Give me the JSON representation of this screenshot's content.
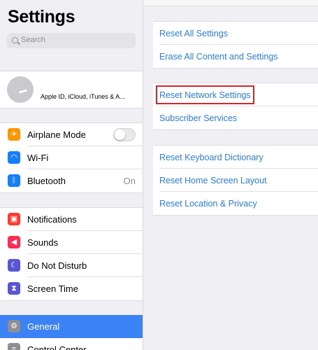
{
  "sidebar": {
    "title": "Settings",
    "search_placeholder": "Search",
    "profile_subtitle": "Apple ID, iCloud, iTunes & A...",
    "group1": [
      {
        "label": "Airplane Mode",
        "icon": "airplane-icon",
        "color": "#ff9500",
        "toggle": false
      },
      {
        "label": "Wi-Fi",
        "icon": "wifi-icon",
        "color": "#147efb"
      },
      {
        "label": "Bluetooth",
        "icon": "bluetooth-icon",
        "color": "#147efb",
        "value": "On"
      }
    ],
    "group2": [
      {
        "label": "Notifications",
        "icon": "notifications-icon",
        "color": "#ff3b30"
      },
      {
        "label": "Sounds",
        "icon": "sounds-icon",
        "color": "#ff2d55"
      },
      {
        "label": "Do Not Disturb",
        "icon": "moon-icon",
        "color": "#5856d6"
      },
      {
        "label": "Screen Time",
        "icon": "hourglass-icon",
        "color": "#5856d6"
      }
    ],
    "group3": [
      {
        "label": "General",
        "icon": "gear-icon",
        "color": "#8e8e93",
        "selected": true
      },
      {
        "label": "Control Center",
        "icon": "control-center-icon",
        "color": "#8e8e93"
      }
    ]
  },
  "detail": {
    "group1": [
      "Reset All Settings",
      "Erase All Content and Settings"
    ],
    "group2": [
      "Reset Network Settings",
      "Subscriber Services"
    ],
    "group3": [
      "Reset Keyboard Dictionary",
      "Reset Home Screen Layout",
      "Reset Location & Privacy"
    ],
    "highlight_color": "#d6262b",
    "link_color": "#2a7df0"
  }
}
